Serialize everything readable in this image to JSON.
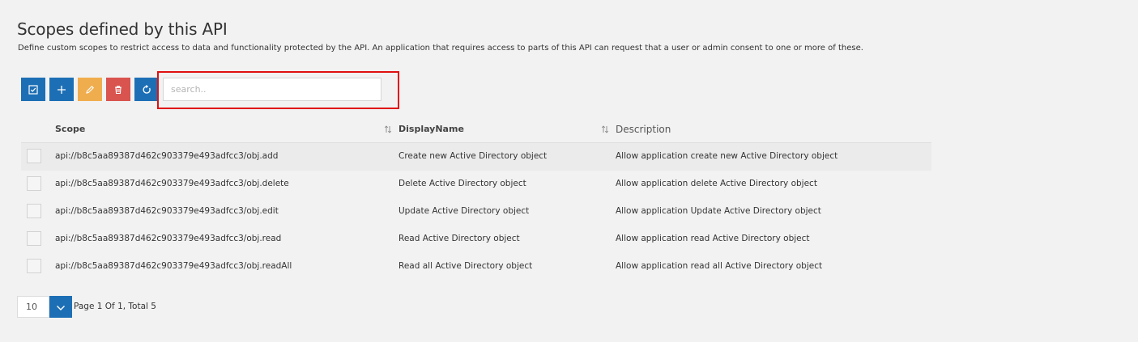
{
  "page": {
    "title": "Scopes defined by this API",
    "description": "Define custom scopes to restrict access to data and functionality protected by the API. An application that requires access to parts of this API can request that a user or admin consent to one or more of these."
  },
  "toolbar": {
    "buttons": [
      {
        "icon": "check-square-icon",
        "color": "#1d6fb5"
      },
      {
        "icon": "plus-icon",
        "color": "#1d6fb5"
      },
      {
        "icon": "pencil-icon",
        "color": "#f0ad4e"
      },
      {
        "icon": "trash-icon",
        "color": "#d9534f"
      },
      {
        "icon": "refresh-icon",
        "color": "#1d6fb5"
      }
    ],
    "search_value": "",
    "search_placeholder": "search.."
  },
  "grid": {
    "columns": {
      "scope": "Scope",
      "display_name": "DisplayName",
      "description": "Description"
    },
    "rows": [
      {
        "scope": "api://b8c5aa89387d462c903379e493adfcc3/obj.add",
        "display_name": "Create new Active Directory object",
        "description": "Allow application create new Active Directory object"
      },
      {
        "scope": "api://b8c5aa89387d462c903379e493adfcc3/obj.delete",
        "display_name": "Delete Active Directory object",
        "description": "Allow application delete Active Directory object"
      },
      {
        "scope": "api://b8c5aa89387d462c903379e493adfcc3/obj.edit",
        "display_name": "Update Active Directory object",
        "description": "Allow application Update Active Directory object"
      },
      {
        "scope": "api://b8c5aa89387d462c903379e493adfcc3/obj.read",
        "display_name": "Read Active Directory object",
        "description": "Allow application read Active Directory object"
      },
      {
        "scope": "api://b8c5aa89387d462c903379e493adfcc3/obj.readAll",
        "display_name": "Read all Active Directory object",
        "description": "Allow application read all Active Directory object"
      }
    ]
  },
  "pager": {
    "page_size": "10",
    "info": "Page 1 Of 1, Total 5"
  },
  "colors": {
    "primary": "#1d6fb5",
    "warning": "#f0ad4e",
    "danger": "#d9534f",
    "highlight": "#e01010"
  }
}
